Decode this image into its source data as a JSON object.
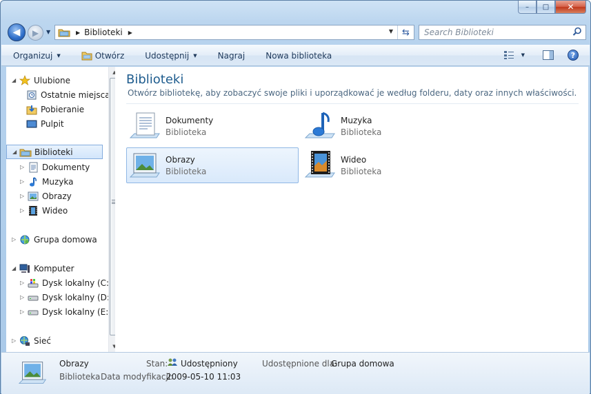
{
  "window": {
    "caption_buttons": [
      "–",
      "□",
      "✕"
    ]
  },
  "nav": {
    "back_glyph": "◀",
    "forward_glyph": "▶"
  },
  "address": {
    "crumb": "Biblioteki",
    "sep": "▶",
    "end_sep": "▶"
  },
  "search": {
    "placeholder": "Search Biblioteki"
  },
  "toolbar": {
    "items": [
      {
        "label": "Organizuj",
        "dropdown": true
      },
      {
        "label": "Otwórz",
        "icon": "folder-icon"
      },
      {
        "label": "Udostępnij",
        "dropdown": true
      },
      {
        "label": "Nagraj"
      },
      {
        "label": "Nowa biblioteka"
      }
    ],
    "help_label": "?"
  },
  "sidebar": {
    "favorites": {
      "label": "Ulubione",
      "items": [
        "Ostatnie miejsca",
        "Pobieranie",
        "Pulpit"
      ]
    },
    "libraries": {
      "label": "Biblioteki",
      "items": [
        "Dokumenty",
        "Muzyka",
        "Obrazy",
        "Wideo"
      ]
    },
    "homegroup": {
      "label": "Grupa domowa"
    },
    "computer": {
      "label": "Komputer",
      "items": [
        "Dysk lokalny (C:)",
        "Dysk lokalny (D:)",
        "Dysk lokalny (E:)"
      ]
    },
    "network": {
      "label": "Sieć"
    }
  },
  "main": {
    "title": "Biblioteki",
    "subtitle": "Otwórz bibliotekę, aby zobaczyć swoje pliki i uporządkować je według folderu, daty oraz innych właściwości.",
    "libraries": [
      {
        "name": "Dokumenty",
        "type": "Biblioteka"
      },
      {
        "name": "Muzyka",
        "type": "Biblioteka"
      },
      {
        "name": "Obrazy",
        "type": "Biblioteka",
        "selected": true
      },
      {
        "name": "Wideo",
        "type": "Biblioteka"
      }
    ]
  },
  "details": {
    "name": "Obrazy",
    "type": "Biblioteka",
    "modified_label": "Data modyfikacji:",
    "modified_value": "2009-05-10 11:03",
    "status_label": "Stan:",
    "status_value": "Udostępniony",
    "shared_label": "Udostępnione dla:",
    "shared_value": "Grupa domowa"
  },
  "colors": {
    "accent": "#1e5c8e",
    "selection_border": "#84acdd"
  }
}
